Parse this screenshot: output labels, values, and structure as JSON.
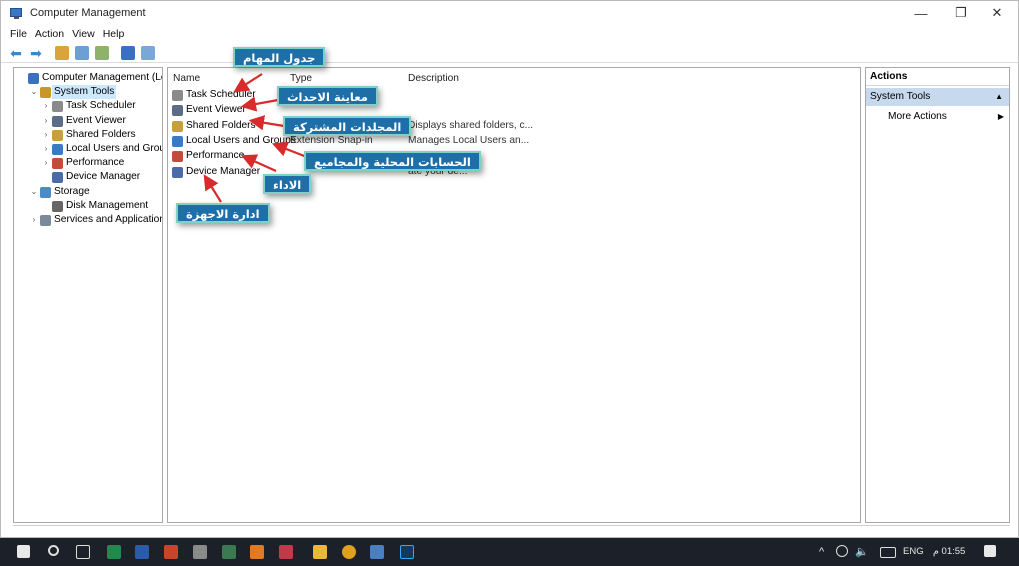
{
  "window": {
    "title": "Computer Management",
    "minimize": "—",
    "restore": "❐",
    "close": "✕"
  },
  "menu": [
    "File",
    "Action",
    "View",
    "Help"
  ],
  "tree": [
    {
      "label": "Computer Management (Local)",
      "expander": "",
      "selected": false,
      "color": "#3a72be"
    },
    {
      "label": "System Tools",
      "expander": "⌄",
      "selected": true,
      "color": "#c9962a"
    },
    {
      "label": "Task Scheduler",
      "expander": "›",
      "selected": false,
      "color": "#8a8a8a"
    },
    {
      "label": "Event Viewer",
      "expander": "›",
      "selected": false,
      "color": "#5b6c86"
    },
    {
      "label": "Shared Folders",
      "expander": "›",
      "selected": false,
      "color": "#c7a03b"
    },
    {
      "label": "Local Users and Groups",
      "expander": "›",
      "selected": false,
      "color": "#3b7ac7"
    },
    {
      "label": "Performance",
      "expander": "›",
      "selected": false,
      "color": "#c44b3b"
    },
    {
      "label": "Device Manager",
      "expander": "",
      "selected": false,
      "color": "#4b6aa8"
    },
    {
      "label": "Storage",
      "expander": "⌄",
      "selected": false,
      "color": "#4a8ac7"
    },
    {
      "label": "Disk Management",
      "expander": "",
      "selected": false,
      "color": "#666666"
    },
    {
      "label": "Services and Applications",
      "expander": "›",
      "selected": false,
      "color": "#7a8a9a"
    }
  ],
  "list": {
    "columns": {
      "name": "Name",
      "type": "Type",
      "description": "Description"
    },
    "rows": [
      {
        "name": "Task Scheduler",
        "type": "",
        "description": "",
        "color": "#8a8a8a"
      },
      {
        "name": "Event Viewer",
        "type": "",
        "description": "",
        "color": "#5b6c86"
      },
      {
        "name": "Shared Folders",
        "type": "",
        "description": "Displays shared folders, c...",
        "color": "#c7a03b"
      },
      {
        "name": "Local Users and Groups",
        "type": "Extension Snap-in",
        "description": "Manages Local Users an...",
        "color": "#3b7ac7"
      },
      {
        "name": "Performance",
        "type": "",
        "description": "",
        "color": "#c44b3b"
      },
      {
        "name": "Device Manager",
        "type": "",
        "description": "ate your de...",
        "color": "#4b6aa8"
      }
    ]
  },
  "actions": {
    "header": "Actions",
    "section": "System Tools",
    "section_caret": "▲",
    "item": "More Actions",
    "item_caret": "▶"
  },
  "callouts": [
    "جدول المهام",
    "معاينة الاحداث",
    "المجلدات المشتركة",
    "الحسابات المحلية والمجاميع",
    "الاداء",
    "ادارة الاجهزة"
  ],
  "tray": {
    "lang": "ENG",
    "time": "01:55 م"
  },
  "colors": {
    "callout_bg": "#1e6ea8",
    "callout_border": "#7fd1c5",
    "arrow": "#d92b2b",
    "selection": "#cce8ff",
    "taskbar": "#1c2029"
  }
}
